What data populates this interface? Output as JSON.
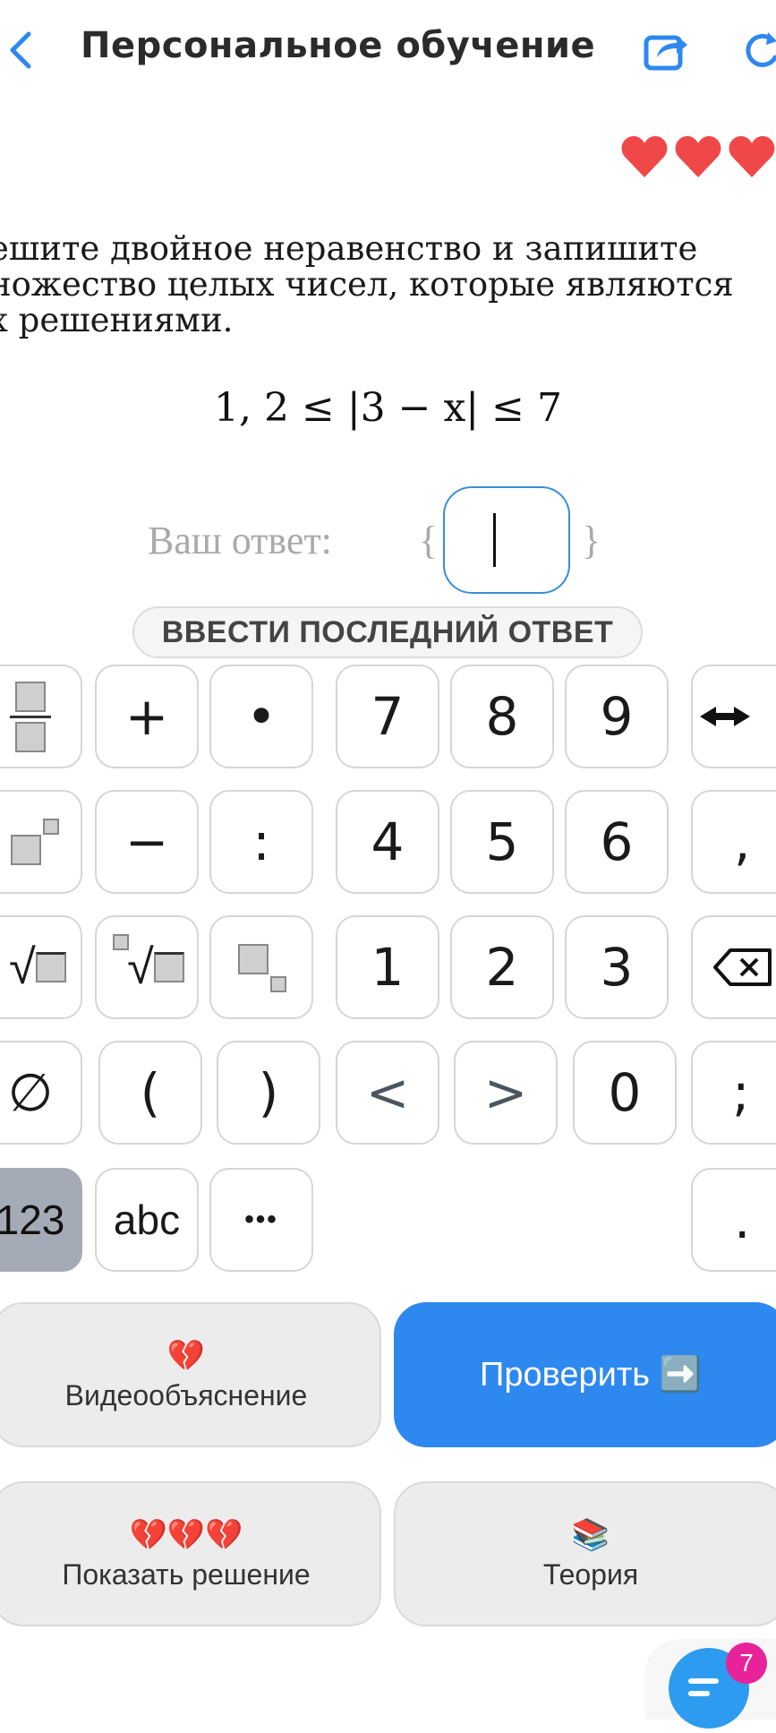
{
  "header": {
    "title": "Персональное обучение",
    "hearts_count": 3,
    "accent_color": "#2d88f0",
    "heart_color": "#f04848"
  },
  "task": {
    "question": "ешите двойное неравенство и запишите\nножество целых чисел, которые являются\nх решениями.",
    "formula": "1, 2 ≤ |3 − x| ≤ 7",
    "answer_label": "Ваш ответ:",
    "brace_open": "{",
    "brace_close": "}",
    "last_answer_button": "ВВЕСТИ ПОСЛЕДНИЙ ОТВЕТ"
  },
  "keyboard": {
    "row1": [
      "+",
      "•",
      "7",
      "8",
      "9"
    ],
    "row2": [
      "−",
      ":",
      "4",
      "5",
      "6",
      ","
    ],
    "row3": [
      "1",
      "2",
      "3"
    ],
    "row4": [
      "∅",
      "(",
      ")",
      "<",
      ">",
      "0",
      ";"
    ],
    "row5": [
      "123",
      "abc",
      "•••",
      "."
    ]
  },
  "actions": {
    "video_emoji": "💔",
    "video_label": "Видеообъяснение",
    "check_label": "Проверить ➡️",
    "solution_emoji": "💔💔💔",
    "solution_label": "Показать решение",
    "theory_emoji": "📚",
    "theory_label": "Теория"
  },
  "chat": {
    "badge_count": "7"
  }
}
